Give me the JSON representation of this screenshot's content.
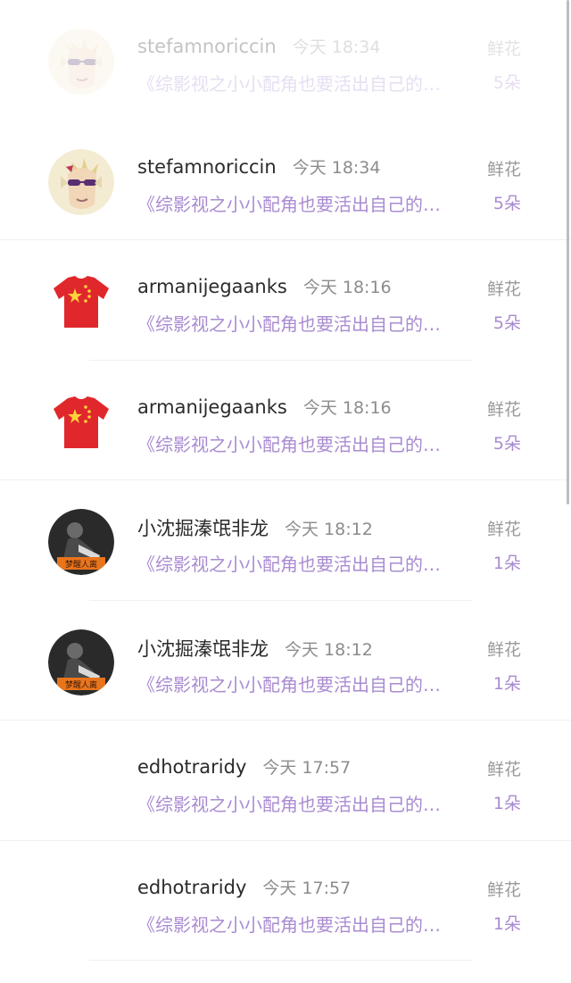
{
  "notifications": [
    {
      "username": "stefamnoriccin",
      "time": "今天 18:34",
      "book": "《综影视之小小配角也要活出自己的…",
      "gift_label": "鲜花",
      "gift_count": "5朵",
      "avatar": "elf-avatar-icon"
    },
    {
      "username": "stefamnoriccin",
      "time": "今天 18:34",
      "book": "《综影视之小小配角也要活出自己的…",
      "gift_label": "鲜花",
      "gift_count": "5朵",
      "avatar": "elf-avatar-icon"
    },
    {
      "username": "armanijegaanks",
      "time": "今天 18:16",
      "book": "《综影视之小小配角也要活出自己的…",
      "gift_label": "鲜花",
      "gift_count": "5朵",
      "avatar": "red-flag-tshirt-icon"
    },
    {
      "username": "armanijegaanks",
      "time": "今天 18:16",
      "book": "《综影视之小小配角也要活出自己的…",
      "gift_label": "鲜花",
      "gift_count": "5朵",
      "avatar": "red-flag-tshirt-icon"
    },
    {
      "username": "小沈掘溱氓非龙",
      "time": "今天 18:12",
      "book": "《综影视之小小配角也要活出自己的…",
      "gift_label": "鲜花",
      "gift_count": "1朵",
      "avatar": "photo-avatar-icon"
    },
    {
      "username": "小沈掘溱氓非龙",
      "time": "今天 18:12",
      "book": "《综影视之小小配角也要活出自己的…",
      "gift_label": "鲜花",
      "gift_count": "1朵",
      "avatar": "photo-avatar-icon"
    },
    {
      "username": "edhotraridy",
      "time": "今天 17:57",
      "book": "《综影视之小小配角也要活出自己的…",
      "gift_label": "鲜花",
      "gift_count": "1朵",
      "avatar": "blank-avatar-icon"
    },
    {
      "username": "edhotraridy",
      "time": "今天 17:57",
      "book": "《综影视之小小配角也要活出自己的…",
      "gift_label": "鲜花",
      "gift_count": "1朵",
      "avatar": "blank-avatar-icon"
    }
  ],
  "colors": {
    "accent_purple": "#a98bd1",
    "name_text": "#2b2b2b",
    "secondary_text": "#8c8c8c",
    "tshirt_red": "#e0282c",
    "star_yellow": "#ffd23c"
  }
}
